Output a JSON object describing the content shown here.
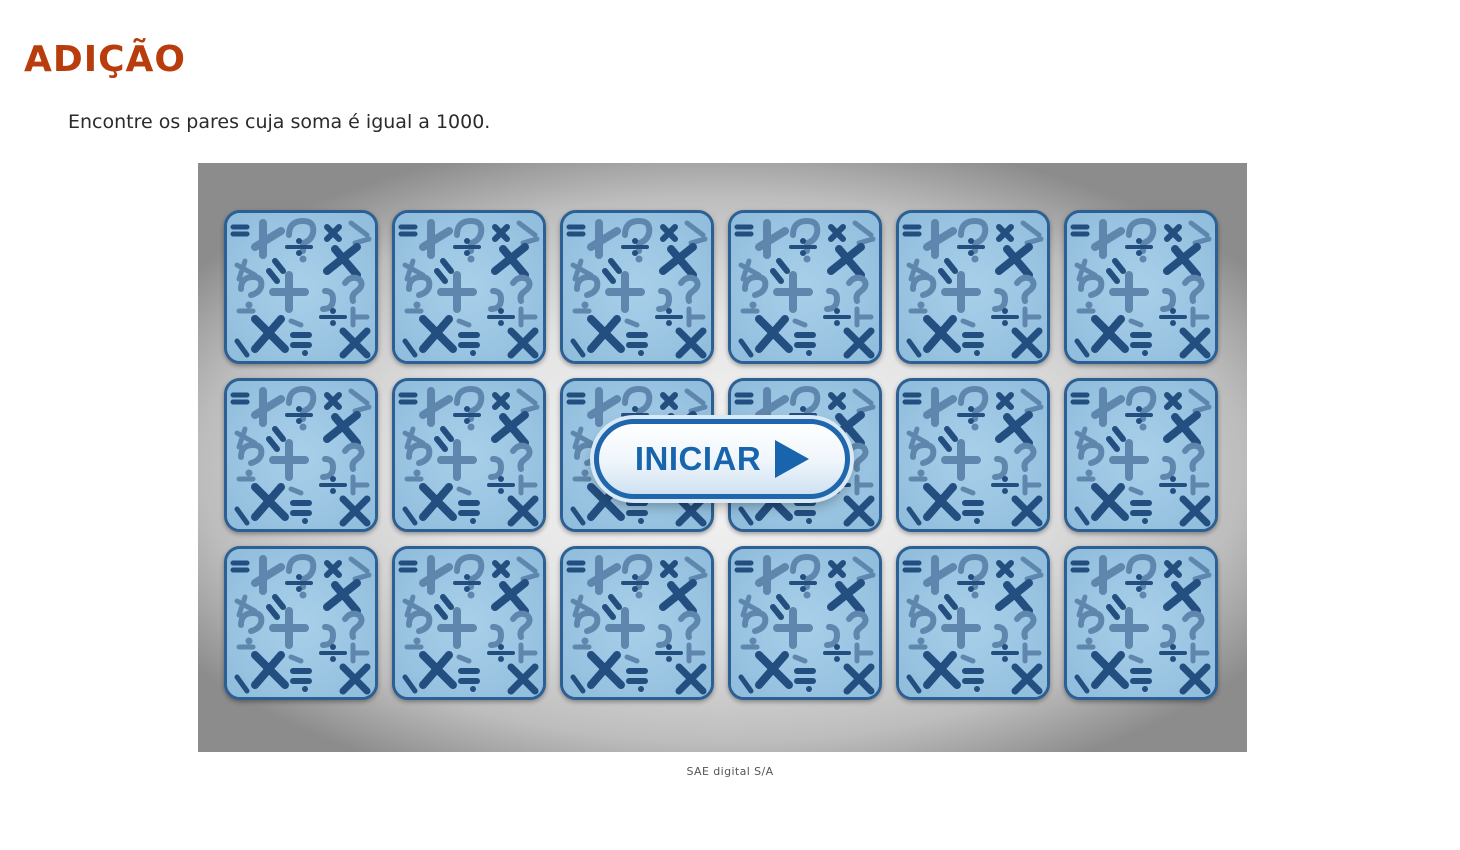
{
  "page": {
    "title": "ADIÇÃO",
    "instruction": "Encontre os pares cuja soma é igual a 1000.",
    "credit": "SAE digital S/A"
  },
  "game": {
    "start_button_label": "INICIAR",
    "start_button_icon": "play-triangle-icon",
    "card_back_pattern": "math-symbols-icon",
    "grid": {
      "rows": 3,
      "columns": 6
    }
  },
  "colors": {
    "title": "#b83c0c",
    "card_fill": "#8fbcdc",
    "card_border": "#2d5f92",
    "symbol_dark": "#234f80",
    "symbol_light": "#5f86ac",
    "button_accent": "#1965ad"
  }
}
